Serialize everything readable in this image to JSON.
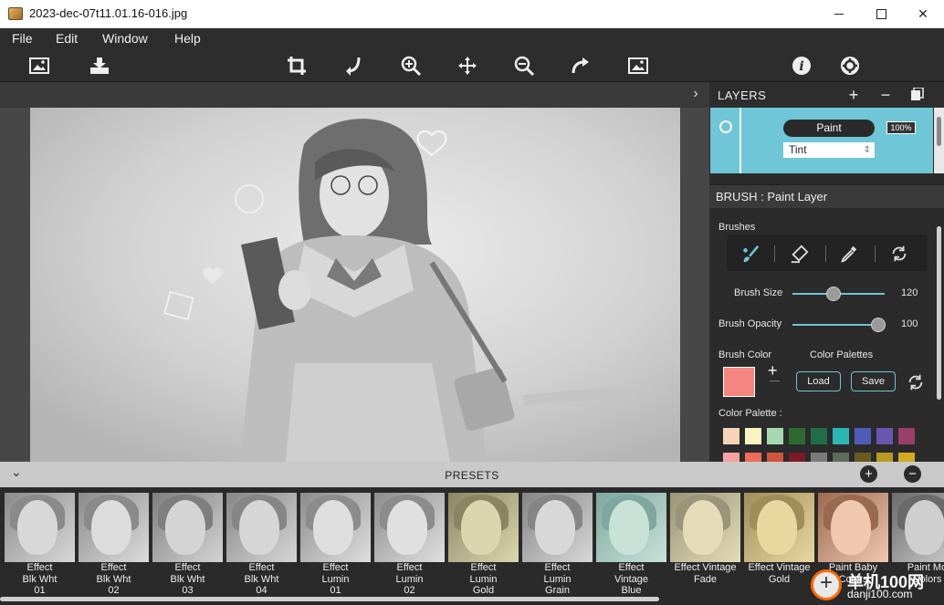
{
  "window": {
    "title": "2023-dec-07t11.01.16-016.jpg",
    "close_glyph": "✕"
  },
  "menu": [
    "File",
    "Edit",
    "Window",
    "Help"
  ],
  "canvas": {
    "expand_glyph": "›"
  },
  "layers": {
    "title": "LAYERS",
    "add_glyph": "+",
    "remove_glyph": "−",
    "layer": {
      "name": "Paint",
      "opacity": "100%",
      "blend": "Tint"
    }
  },
  "brush": {
    "title": "BRUSH : Paint Layer",
    "brushes_label": "Brushes",
    "size_label": "Brush Size",
    "size_value": "120",
    "size_fraction": 0.45,
    "opacity_label": "Brush Opacity",
    "opacity_value": "100",
    "opacity_fraction": 0.93,
    "color_label": "Brush Color",
    "color": "#f48580",
    "palettes_label": "Color Palettes",
    "load_label": "Load",
    "save_label": "Save",
    "palette_label": "Color Palette :",
    "add_glyph": "+",
    "palette_row1": [
      "#f7d4b8",
      "#fbf4c2",
      "#a8d8b2",
      "#2e6a30",
      "#1f6e48",
      "#2ab7b4",
      "#4f5db8",
      "#6a56b0",
      "#9a3e6a"
    ],
    "palette_row2": [
      "#f4a3a0",
      "#f06a5a",
      "#d0553a",
      "#7a1a24",
      "#7a7a7a",
      "#5e6a5a",
      "#6a5a20",
      "#b89a20",
      "#d4a820"
    ]
  },
  "presets": {
    "title": "PRESETS",
    "collapse_glyph": "⌄",
    "add_glyph": "+",
    "remove_glyph": "−",
    "items": [
      {
        "label": "Effect\nBlk Wht\n01",
        "tone": "#8a8a8a",
        "skin": "#d8d8d8"
      },
      {
        "label": "Effect\nBlk Wht\n02",
        "tone": "#8a8a8a",
        "skin": "#dcdcdc"
      },
      {
        "label": "Effect\nBlk Wht\n03",
        "tone": "#7e7e7e",
        "skin": "#d4d4d4"
      },
      {
        "label": "Effect\nBlk Wht\n04",
        "tone": "#868686",
        "skin": "#d6d6d6"
      },
      {
        "label": "Effect\nLumin\n01",
        "tone": "#8c8c8c",
        "skin": "#dedede"
      },
      {
        "label": "Effect\nLumin\n02",
        "tone": "#8c8c8c",
        "skin": "#e0e0e0"
      },
      {
        "label": "Effect\nLumin\nGold",
        "tone": "#8a8664",
        "skin": "#dcd6b0"
      },
      {
        "label": "Effect\nLumin\nGrain",
        "tone": "#858585",
        "skin": "#d8d8d8"
      },
      {
        "label": "Effect\nVintage\nBlue",
        "tone": "#7fa7a0",
        "skin": "#c8e2d8"
      },
      {
        "label": "Effect Vintage\nFade",
        "tone": "#9a9478",
        "skin": "#e4dcb8"
      },
      {
        "label": "Effect Vintage\nGold",
        "tone": "#a08e5a",
        "skin": "#e8d8a0"
      },
      {
        "label": "Paint Baby\nColors",
        "tone": "#9a6a50",
        "skin": "#f0c8b0"
      },
      {
        "label": "Paint Mo\nColors",
        "tone": "#6a6a6a",
        "skin": "#cfcfcf"
      }
    ]
  },
  "watermark": {
    "line1": "单机100网",
    "line2": "danji100.com"
  }
}
